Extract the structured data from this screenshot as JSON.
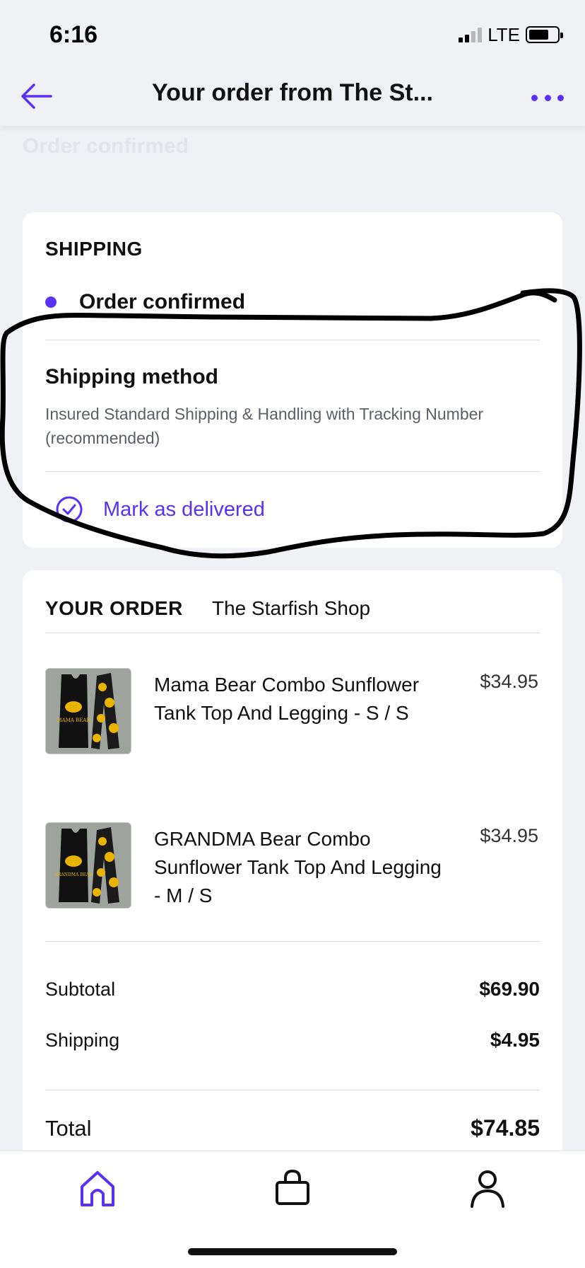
{
  "status_bar": {
    "time": "6:16",
    "network": "LTE"
  },
  "nav": {
    "title": "Your order from The St...",
    "back_icon": "arrow-left-icon",
    "more_icon": "ellipsis-icon"
  },
  "page": {
    "faded_title": "Order confirmed"
  },
  "shipping": {
    "heading": "SHIPPING",
    "status": "Order confirmed",
    "method_heading": "Shipping method",
    "method_description": "Insured Standard Shipping & Handling with Tracking Number (recommended)",
    "mark_delivered_label": "Mark as delivered"
  },
  "order": {
    "heading": "YOUR ORDER",
    "shop_name": "The Starfish Shop",
    "items": [
      {
        "name": "Mama Bear Combo Sunflower Tank Top And Legging - S / S",
        "price": "$34.95",
        "thumb_text": "MAMA BEAR"
      },
      {
        "name": "GRANDMA Bear Combo Sunflower Tank Top And Legging - M / S",
        "price": "$34.95",
        "thumb_text": "GRANDMA BEAR"
      }
    ],
    "summary": {
      "subtotal_label": "Subtotal",
      "subtotal_value": "$69.90",
      "shipping_label": "Shipping",
      "shipping_value": "$4.95",
      "total_label": "Total",
      "total_value": "$74.85"
    }
  },
  "tab_bar": {
    "tabs": [
      "home-icon",
      "shopping-bag-icon",
      "account-icon"
    ],
    "active": "home-icon"
  },
  "colors": {
    "accent": "#5a31f4",
    "background": "#f0f1f5",
    "card": "#ffffff"
  }
}
